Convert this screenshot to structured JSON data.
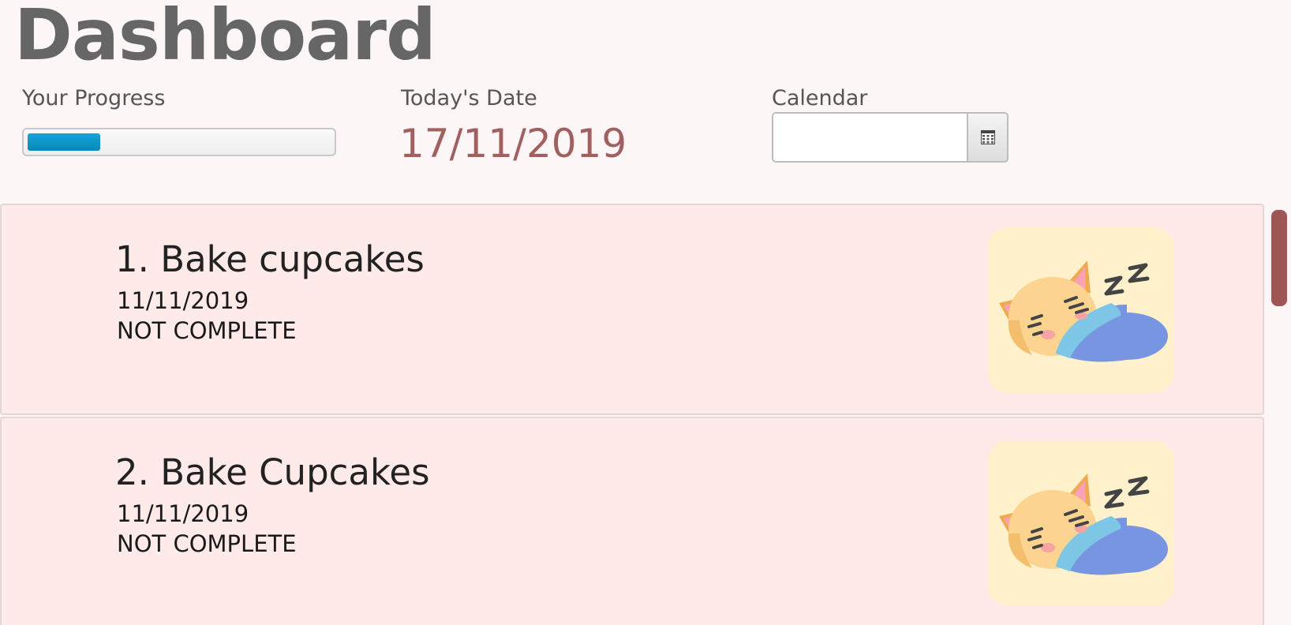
{
  "header": {
    "title": "Dashboard"
  },
  "progress": {
    "label": "Your Progress",
    "fraction": 0.24
  },
  "today": {
    "label": "Today's Date",
    "value": "17/11/2019"
  },
  "calendar": {
    "label": "Calendar",
    "value": "",
    "button_icon": "calendar-grid-icon"
  },
  "tasks": [
    {
      "title": "1.  Bake cupcakes",
      "date": "11/11/2019",
      "status": "NOT COMPLETE",
      "image": "sleeping-cat-icon"
    },
    {
      "title": "2.  Bake Cupcakes",
      "date": "11/11/2019",
      "status": "NOT COMPLETE",
      "image": "sleeping-cat-icon"
    }
  ],
  "colors": {
    "accent": "#9d5555",
    "date_text": "#a06060",
    "progress_fill": "#0a94c8",
    "card_bg": "#ffeaea",
    "image_bg": "#fff1cc"
  }
}
